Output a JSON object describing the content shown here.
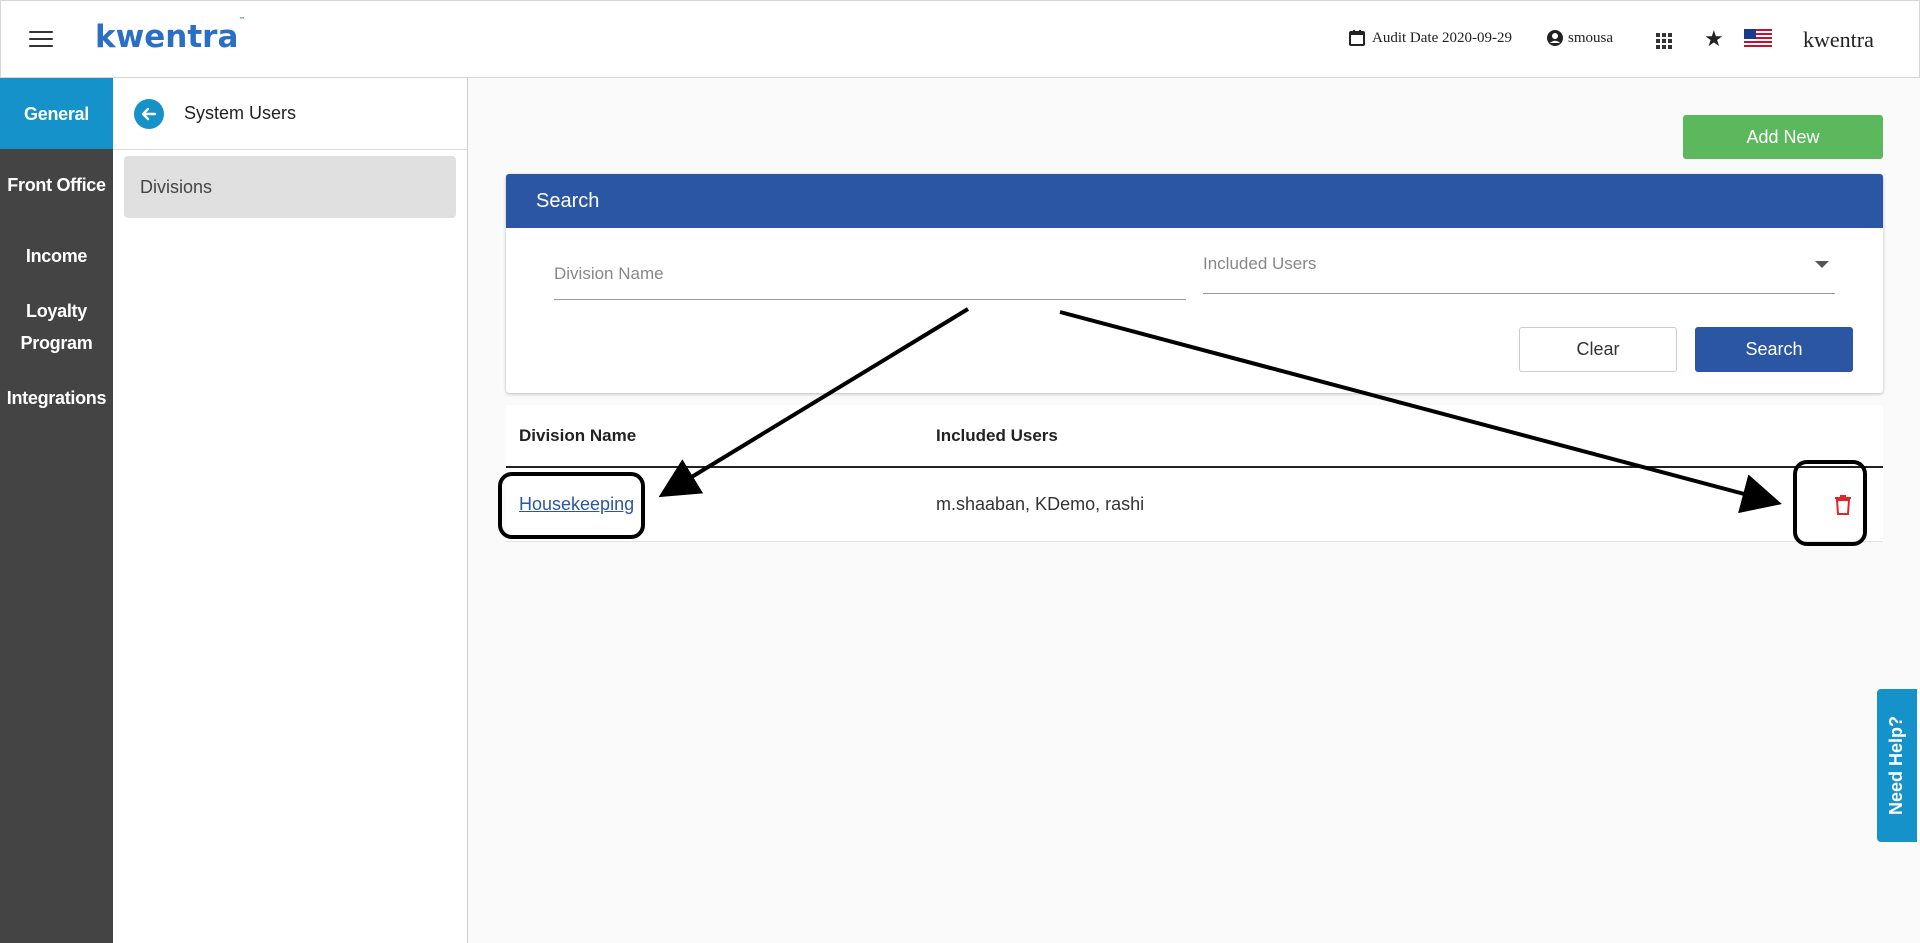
{
  "app": {
    "brand_logo": "kwentra",
    "brand_tm": "™",
    "brand_text": "kwentra"
  },
  "topbar": {
    "audit_date": "Audit Date 2020-09-29",
    "user": "smousa"
  },
  "leftnav": {
    "items": [
      {
        "label": "General",
        "active": true
      },
      {
        "label": "Front Office"
      },
      {
        "label": "Income"
      },
      {
        "label": "Loyalty Program"
      },
      {
        "label": "Integrations"
      }
    ]
  },
  "subpanel": {
    "title": "System Users",
    "items": [
      {
        "label": "Divisions"
      }
    ]
  },
  "main": {
    "add_label": "Add New",
    "search": {
      "header": "Search",
      "division_placeholder": "Division Name",
      "users_placeholder": "Included Users",
      "clear_label": "Clear",
      "search_label": "Search"
    },
    "table": {
      "columns": [
        "Division Name",
        "Included Users"
      ],
      "rows": [
        {
          "division": "Housekeeping",
          "users": "m.shaaban, KDemo, rashi"
        }
      ]
    }
  },
  "help": {
    "label": "Need Help?"
  },
  "colors": {
    "accent": "#1492c9",
    "primary": "#2b56a4",
    "success": "#5cb85c",
    "danger": "#e0262a"
  }
}
